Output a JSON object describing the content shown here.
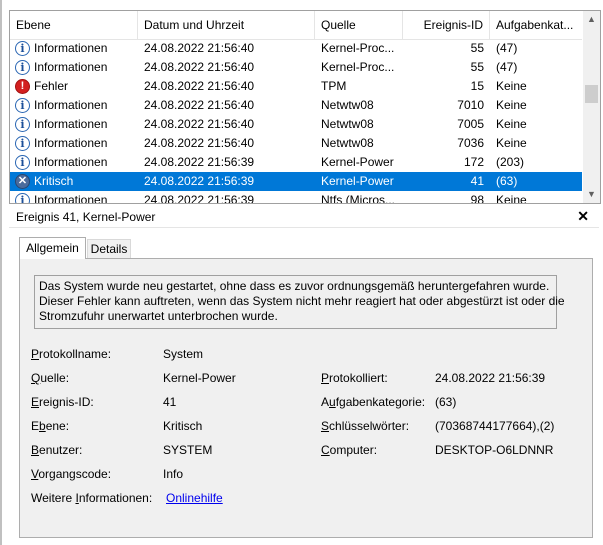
{
  "grid": {
    "columns": {
      "level": "Ebene",
      "datetime": "Datum und Uhrzeit",
      "source": "Quelle",
      "event_id": "Ereignis-ID",
      "task": "Aufgabenkat..."
    },
    "rows": [
      {
        "level": "Informationen",
        "icon": "info-icon",
        "datetime": "24.08.2022 21:56:40",
        "source": "Kernel-Proc...",
        "event_id": "55",
        "task": "(47)"
      },
      {
        "level": "Informationen",
        "icon": "info-icon",
        "datetime": "24.08.2022 21:56:40",
        "source": "Kernel-Proc...",
        "event_id": "55",
        "task": "(47)"
      },
      {
        "level": "Fehler",
        "icon": "error-icon",
        "datetime": "24.08.2022 21:56:40",
        "source": "TPM",
        "event_id": "15",
        "task": "Keine"
      },
      {
        "level": "Informationen",
        "icon": "info-icon",
        "datetime": "24.08.2022 21:56:40",
        "source": "Netwtw08",
        "event_id": "7010",
        "task": "Keine"
      },
      {
        "level": "Informationen",
        "icon": "info-icon",
        "datetime": "24.08.2022 21:56:40",
        "source": "Netwtw08",
        "event_id": "7005",
        "task": "Keine"
      },
      {
        "level": "Informationen",
        "icon": "info-icon",
        "datetime": "24.08.2022 21:56:40",
        "source": "Netwtw08",
        "event_id": "7036",
        "task": "Keine"
      },
      {
        "level": "Informationen",
        "icon": "info-icon",
        "datetime": "24.08.2022 21:56:39",
        "source": "Kernel-Power",
        "event_id": "172",
        "task": "(203)"
      },
      {
        "level": "Kritisch",
        "icon": "critical-icon",
        "datetime": "24.08.2022 21:56:39",
        "source": "Kernel-Power",
        "event_id": "41",
        "task": "(63)",
        "selected": true
      },
      {
        "level": "Informationen",
        "icon": "info-icon",
        "datetime": "24.08.2022 21:56:39",
        "source": "Ntfs (Micros...",
        "event_id": "98",
        "task": "Keine"
      }
    ]
  },
  "detail": {
    "title": "Ereignis 41, Kernel-Power",
    "tabs": {
      "general": "Allgemein",
      "details": "Details"
    },
    "description": [
      "Das System wurde neu gestartet, ohne dass es zuvor ordnungsgemäß heruntergefahren wurde.",
      "Dieser Fehler kann auftreten, wenn das System nicht mehr reagiert hat oder abgestürzt ist oder die",
      "Stromzufuhr unerwartet unterbrochen wurde."
    ],
    "fields": {
      "log_name": {
        "label": "Protokollname:",
        "value": "System"
      },
      "source": {
        "label": "Quelle:",
        "value": "Kernel-Power"
      },
      "logged": {
        "label": "Protokolliert:",
        "value": "24.08.2022 21:56:39"
      },
      "event_id": {
        "label": "Ereignis-ID:",
        "value": "41"
      },
      "task_category": {
        "label": "Aufgabenkategorie:",
        "value": "(63)"
      },
      "level": {
        "label": "Ebene:",
        "value": "Kritisch"
      },
      "keywords": {
        "label": "Schlüsselwörter:",
        "value": "(70368744177664),(2)"
      },
      "user": {
        "label": "Benutzer:",
        "value": "SYSTEM"
      },
      "computer": {
        "label": "Computer:",
        "value": "DESKTOP-O6LDNNR"
      },
      "opcode": {
        "label": "Vorgangscode:",
        "value": "Info"
      },
      "more_info": {
        "label": "Weitere Informationen:",
        "value": "Onlinehilfe"
      }
    }
  },
  "colors": {
    "selection": "#0078d7",
    "link": "#0000ee",
    "error": "#d32020",
    "critical": "#4b6b9c",
    "info": "#2a66b3"
  }
}
